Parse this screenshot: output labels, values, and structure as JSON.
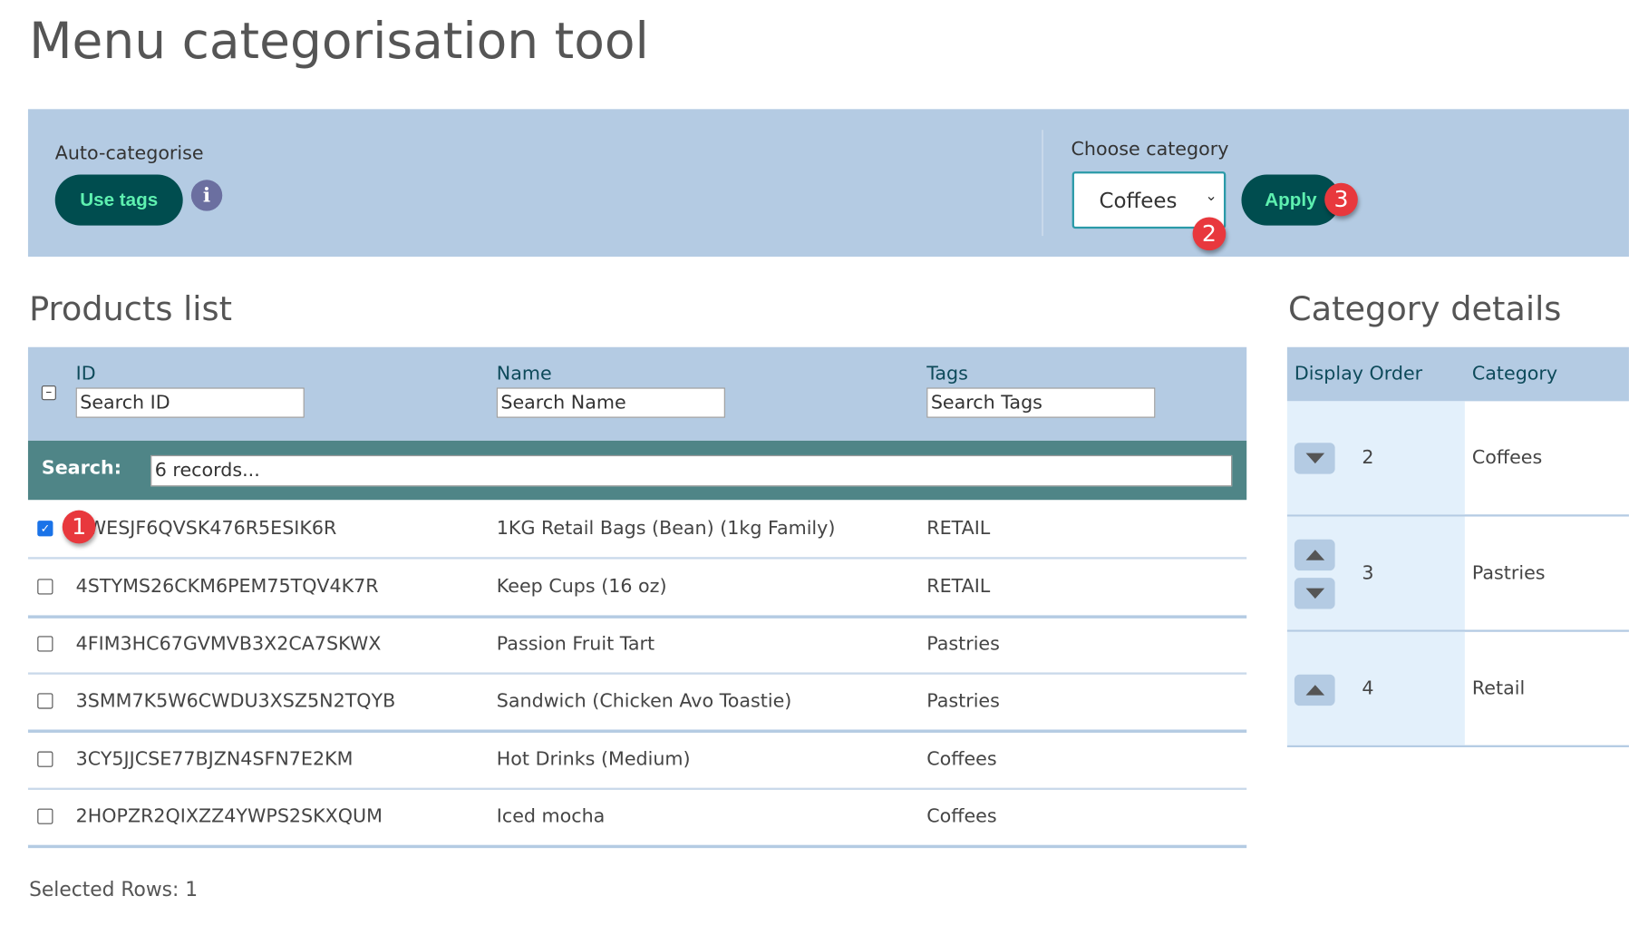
{
  "title": "Menu categorisation tool",
  "toolbar": {
    "auto_label": "Auto-categorise",
    "use_tags": "Use tags",
    "info": "i",
    "choose_label": "Choose category",
    "category_selected": "Coffees",
    "apply": "Apply",
    "badges": [
      "1",
      "2",
      "3"
    ]
  },
  "products": {
    "heading": "Products list",
    "columns": [
      {
        "label": "ID",
        "placeholder": "Search ID"
      },
      {
        "label": "Name",
        "placeholder": "Search Name"
      },
      {
        "label": "Tags",
        "placeholder": "Search Tags"
      }
    ],
    "search_label": "Search:",
    "search_placeholder": "6 records...",
    "rows": [
      {
        "id": "2WESJF6QVSK476R5ESIK6R",
        "name": "1KG Retail Bags (Bean) (1kg Family)",
        "tags": "RETAIL",
        "checked": true
      },
      {
        "id": "4STYMS26CKM6PEM75TQV4K7R",
        "name": "Keep Cups (16 oz)",
        "tags": "RETAIL",
        "checked": false
      },
      {
        "id": "4FIM3HC67GVMVB3X2CA7SKWX",
        "name": "Passion Fruit Tart",
        "tags": "Pastries",
        "checked": false
      },
      {
        "id": "3SMM7K5W6CWDU3XSZ5N2TQYB",
        "name": "Sandwich (Chicken Avo Toastie)",
        "tags": "Pastries",
        "checked": false
      },
      {
        "id": "3CY5JJCSE77BJZN4SFN7E2KM",
        "name": "Hot Drinks (Medium)",
        "tags": "Coffees",
        "checked": false
      },
      {
        "id": "2HOPZR2QIXZZ4YWPS2SKXQUM",
        "name": "Iced mocha",
        "tags": "Coffees",
        "checked": false
      }
    ],
    "selected_rows": "Selected Rows: 1"
  },
  "category": {
    "heading": "Category details",
    "col_order": "Display Order",
    "col_category": "Category",
    "rows": [
      {
        "order": "2",
        "name": "Coffees",
        "up": false,
        "down": true
      },
      {
        "order": "3",
        "name": "Pastries",
        "up": true,
        "down": true
      },
      {
        "order": "4",
        "name": "Retail",
        "up": true,
        "down": false
      }
    ]
  },
  "colors": {
    "panel": "#b4cbe3",
    "button": "#004d4f",
    "button_text": "#5ef0b0",
    "search_bar": "#4f8587",
    "badge": "#e8383d"
  }
}
